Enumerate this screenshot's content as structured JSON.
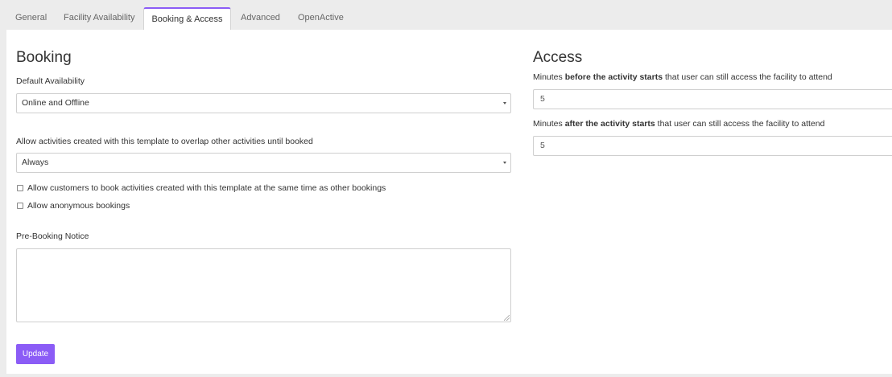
{
  "tabs": [
    "General",
    "Facility Availability",
    "Booking & Access",
    "Advanced",
    "OpenActive"
  ],
  "active_tab": "Booking & Access",
  "booking": {
    "heading": "Booking",
    "default_availability_label": "Default Availability",
    "default_availability_value": "Online and Offline",
    "overlap_label": "Allow activities created with this template to overlap other activities until booked",
    "overlap_value": "Always",
    "same_time_checkbox_label": "Allow customers to book activities created with this template at the same time as other bookings",
    "same_time_checked": false,
    "anonymous_checkbox_label": "Allow anonymous bookings",
    "anonymous_checked": false,
    "pre_booking_notice_label": "Pre-Booking Notice",
    "pre_booking_notice_value": "",
    "update_button": "Update"
  },
  "access": {
    "heading": "Access",
    "before": {
      "prefix": "Minutes ",
      "bold": "before the activity starts",
      "suffix": " that user can still access the facility to attend",
      "value": "5"
    },
    "after": {
      "prefix": "Minutes ",
      "bold": "after the activity starts",
      "suffix": " that user can still access the facility to attend",
      "value": "5"
    }
  },
  "colors": {
    "accent": "#8b5cf6",
    "page_background": "#ececec",
    "panel_background": "#ffffff"
  }
}
